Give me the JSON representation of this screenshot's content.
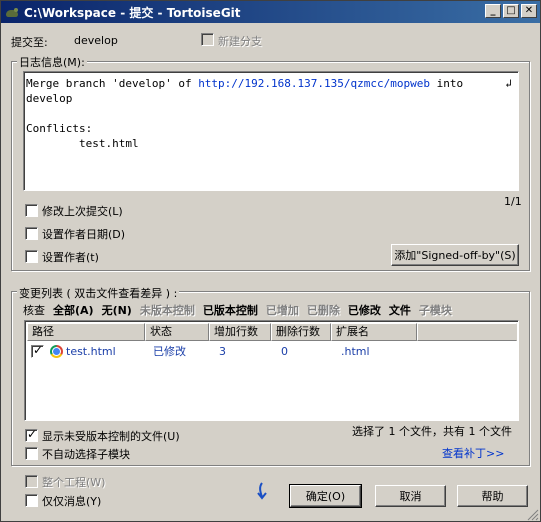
{
  "window": {
    "title": "C:\\Workspace - 提交 - TortoiseGit",
    "min_label": "_",
    "max_label": "□",
    "close_label": "✕"
  },
  "commit_to": {
    "label": "提交至:",
    "branch": "develop",
    "new_branch_label": "新建分支"
  },
  "message_group": {
    "title": "日志信息(M):",
    "line1_a": "Merge branch 'develop' of ",
    "line1_url": "http://192.168.137.135/qzmcc/mopweb",
    "line1_b": " into",
    "line2": "develop",
    "line4": "Conflicts:",
    "line5": "        test.html",
    "wrap_mark": "↲",
    "counter": "1/1",
    "amend_label": "修改上次提交(L)",
    "set_date_label": "设置作者日期(D)",
    "set_author_label": "设置作者(t)",
    "signed_off_button": "添加\"Signed-off-by\"(S)"
  },
  "changes_group": {
    "title": "变更列表 ( 双击文件查看差异 ) :",
    "filters": {
      "check": "核查",
      "all": "全部(A)",
      "none": "无(N)",
      "unversioned": "未版本控制",
      "versioned": "已版本控制",
      "added": "已增加",
      "deleted": "已删除",
      "modified": "已修改",
      "files": "文件",
      "submodules": "子模块"
    },
    "columns": [
      "路径",
      "状态",
      "增加行数",
      "删除行数",
      "扩展名"
    ],
    "rows": [
      {
        "path": "test.html",
        "status": "已修改",
        "added": "3",
        "deleted": "0",
        "ext": ".html",
        "checked": true
      }
    ],
    "show_unversioned_label": "显示未受版本控制的文件(U)",
    "no_autoselect_label": "不自动选择子模块",
    "selection_summary": "选择了 1 个文件，共有 1 个文件",
    "view_patch_link": "查看补丁>>"
  },
  "footer": {
    "whole_project_label": "整个工程(W)",
    "message_only_label": "仅仅消息(Y)",
    "ok_button": "确定(O)",
    "cancel_button": "取消",
    "help_button": "帮助"
  }
}
